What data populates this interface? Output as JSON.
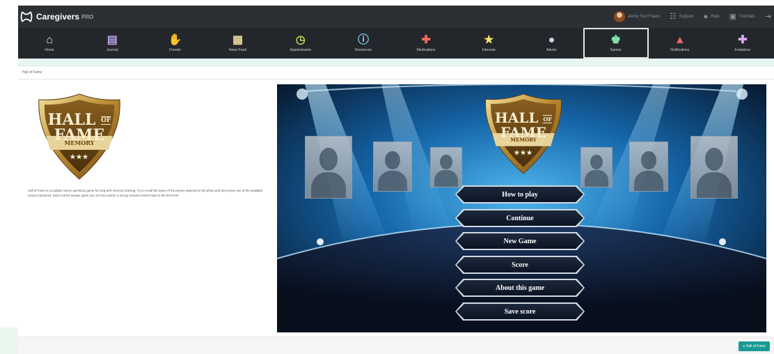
{
  "app": {
    "name": "Caregivers",
    "pro": "PRO"
  },
  "topbar": {
    "user_name": "Jenny Sort Flaws",
    "items": [
      {
        "label": "Support",
        "icon": "support-icon"
      },
      {
        "label": "Help",
        "icon": "help-icon"
      },
      {
        "label": "Tutorials",
        "icon": "tutorial-icon"
      }
    ]
  },
  "nav": {
    "items": [
      {
        "label": "Home",
        "icon": "home-icon",
        "glyph": "⌂",
        "color": "#e8e8e8"
      },
      {
        "label": "Journal",
        "icon": "journal-icon",
        "glyph": "▤",
        "color": "#b9a0e6"
      },
      {
        "label": "Friends",
        "icon": "handshake-icon",
        "glyph": "✋",
        "color": "#e87b8a"
      },
      {
        "label": "News Feed",
        "icon": "newspaper-icon",
        "glyph": "▦",
        "color": "#e6d49a"
      },
      {
        "label": "Appointments",
        "icon": "clock-icon",
        "glyph": "◷",
        "color": "#b7e04a"
      },
      {
        "label": "Resources",
        "icon": "info-icon",
        "glyph": "ⓘ",
        "color": "#7fd6f5"
      },
      {
        "label": "Medications",
        "icon": "medkit-icon",
        "glyph": "✚",
        "color": "#f06a5a"
      },
      {
        "label": "Interests",
        "icon": "star-icon",
        "glyph": "★",
        "color": "#f7e36b"
      },
      {
        "label": "Advice",
        "icon": "chat-icon",
        "glyph": "●",
        "color": "#c8d4e0"
      },
      {
        "label": "Games",
        "icon": "trophy-icon",
        "glyph": "♚",
        "color": "#7ee0a8"
      },
      {
        "label": "Notifications",
        "icon": "bell-icon",
        "glyph": "▲",
        "color": "#f06464"
      },
      {
        "label": "Invitations",
        "icon": "add-user-icon",
        "glyph": "✚",
        "color": "#d8a6f0"
      }
    ],
    "active_index": 9
  },
  "breadcrumb": "Hall of Fame",
  "hall_of_fame": {
    "line1": "HALL",
    "of": "OF",
    "line2": "FAME",
    "sub": "MEMORY",
    "stars": "★★★"
  },
  "description": "Hall of Fame is a multiple choice questions game for long-term memory training. Try to recall the name of the person depicted in the photo and then press one of the available choices (buttons). Each correct answer gives you 10 more points. 5 wrong Answers resets back to the first level.",
  "game_menu": [
    "How to play",
    "Continue",
    "New Game",
    "Score",
    "About this game",
    "Save score"
  ],
  "footer": {
    "button_label": "Hall of Fame"
  },
  "colors": {
    "accent": "#1a9a94",
    "topbar": "#2c2f33",
    "navbar": "#23272b",
    "gold": "#c9a24a"
  }
}
